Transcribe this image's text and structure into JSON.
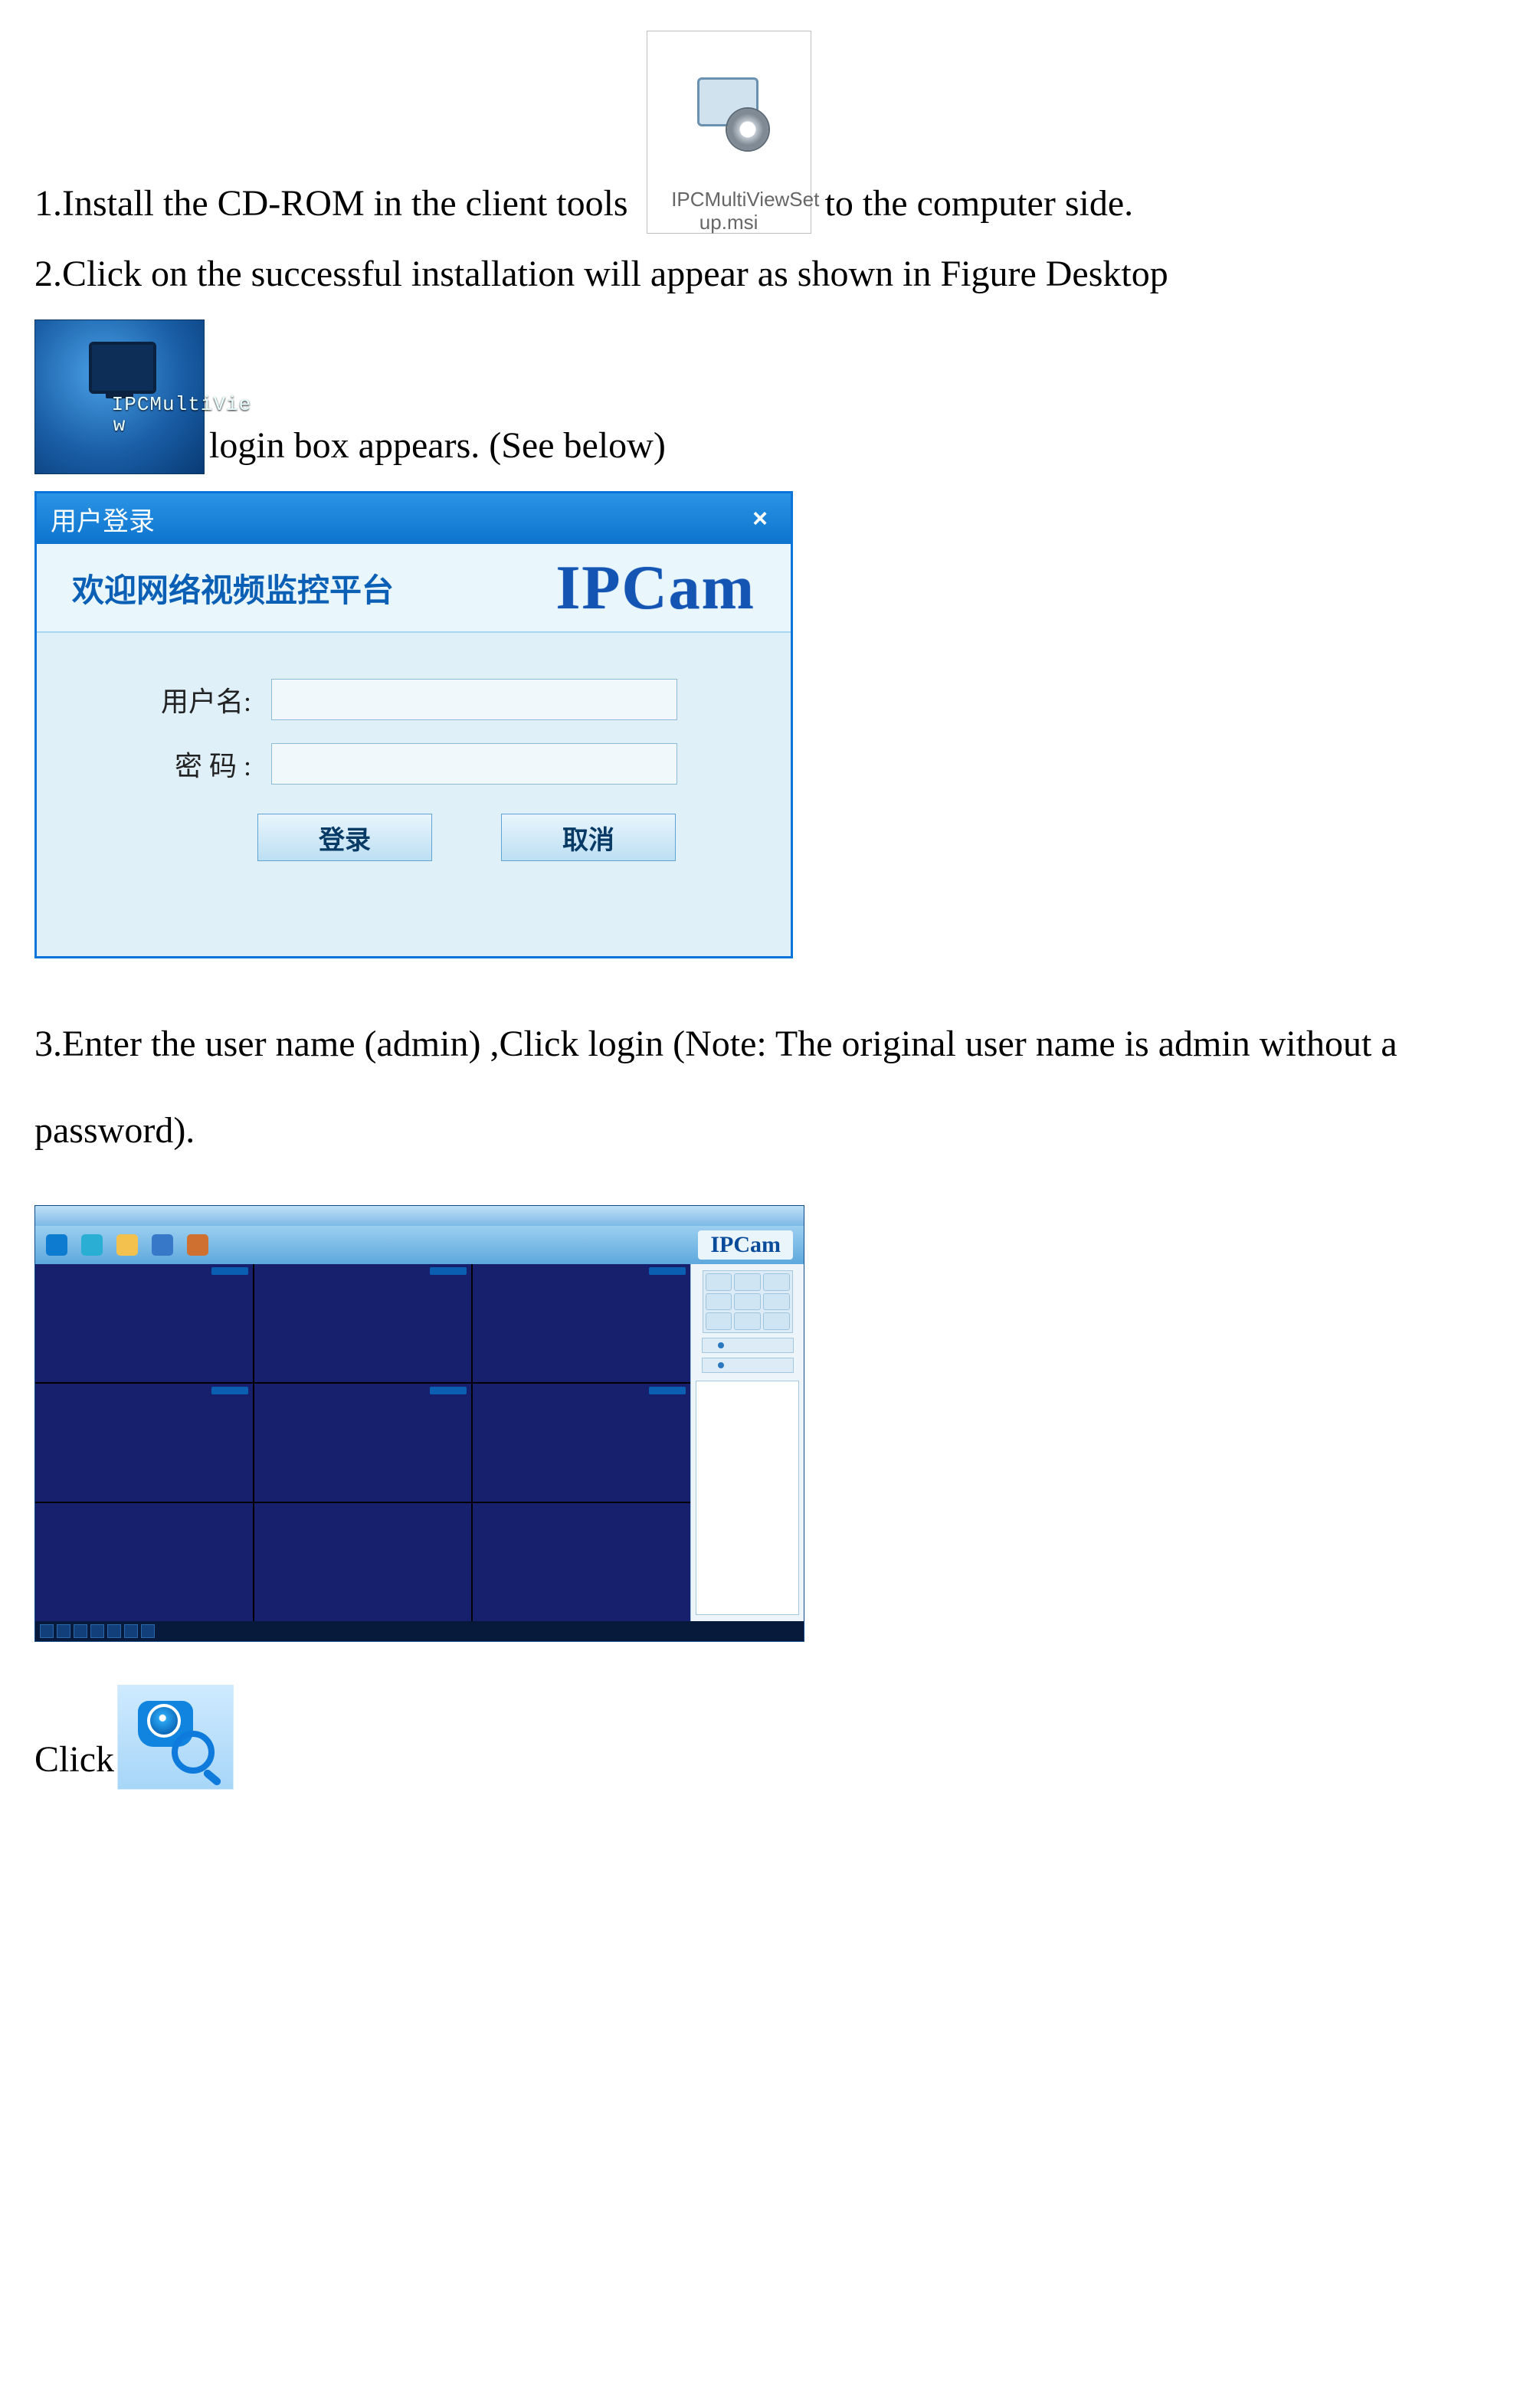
{
  "text": {
    "step1_a": "1.Install the CD-ROM in the client tools",
    "step1_b": " to the computer side.",
    "step2": "2.Click on the successful installation will appear as shown in Figure Desktop",
    "step2_b": "login box appears. (See below)",
    "step3": "3.Enter the user name (admin) ,Click login (Note: The original user name is admin without a password).",
    "step4_a": "Click"
  },
  "msi": {
    "label_l1": "IPCMultiViewSet",
    "label_l2": "up.msi"
  },
  "desktop_icon": {
    "label_l1": "IPCMultiVie",
    "label_l2": "w"
  },
  "login": {
    "title": "用户登录",
    "welcome": "欢迎网络视频监控平台",
    "logo": "IPCam",
    "user_label": "用户名:",
    "pass_label": "密 码 :",
    "btn_login": "登录",
    "btn_cancel": "取消"
  },
  "app": {
    "logo": "IPCam"
  }
}
